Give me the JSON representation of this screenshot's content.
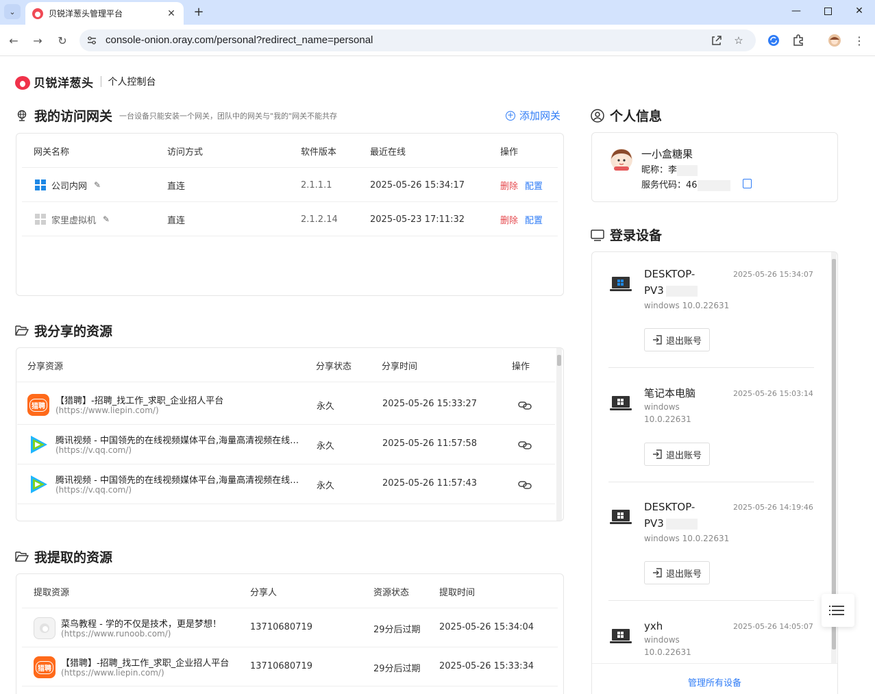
{
  "browser": {
    "tab_title": "贝锐洋葱头管理平台",
    "url": "console-onion.oray.com/personal?redirect_name=personal"
  },
  "brand": {
    "name": "贝锐洋葱头",
    "sub": "个人控制台"
  },
  "gateway": {
    "title": "我的访问网关",
    "hint": "一台设备只能安装一个网关，团队中的网关与\"我的\"网关不能共存",
    "add_label": "添加网关",
    "columns": [
      "网关名称",
      "访问方式",
      "软件版本",
      "最近在线",
      "操作"
    ],
    "rows": [
      {
        "name": "公司内网",
        "mode": "直连",
        "version": "2.1.1.1",
        "online": "2025-05-26 15:34:17",
        "del": "删除",
        "cfg": "配置",
        "active": true
      },
      {
        "name": "家里虚拟机",
        "mode": "直连",
        "version": "2.1.2.14",
        "online": "2025-05-23 17:11:32",
        "del": "删除",
        "cfg": "配置",
        "active": false
      }
    ]
  },
  "shared": {
    "title": "我分享的资源",
    "columns": [
      "分享资源",
      "分享状态",
      "分享时间",
      "操作"
    ],
    "rows": [
      {
        "title": "【猎聘】-招聘_找工作_求职_企业招人平台",
        "url": "(https://www.liepin.com/)",
        "status": "永久",
        "time": "2025-05-26 15:33:27",
        "icon": "liepin"
      },
      {
        "title": "腾讯视频 - 中国领先的在线视频媒体平台,海量高清视频在线观看",
        "url": "(https://v.qq.com/)",
        "status": "永久",
        "time": "2025-05-26 11:57:58",
        "icon": "tencent"
      },
      {
        "title": "腾讯视频 - 中国领先的在线视频媒体平台,海量高清视频在线观看",
        "url": "(https://v.qq.com/)",
        "status": "永久",
        "time": "2025-05-26 11:57:43",
        "icon": "tencent"
      }
    ]
  },
  "extracted": {
    "title": "我提取的资源",
    "columns": [
      "提取资源",
      "分享人",
      "资源状态",
      "提取时间"
    ],
    "rows": [
      {
        "title": "菜鸟教程 - 学的不仅是技术，更是梦想！",
        "url": "(https://www.runoob.com/)",
        "sharer": "13710680719",
        "status": "29分后过期",
        "time": "2025-05-26 15:34:04",
        "icon": "runoob"
      },
      {
        "title": "【猎聘】-招聘_找工作_求职_企业招人平台",
        "url": "(https://www.liepin.com/)",
        "sharer": "13710680719",
        "status": "29分后过期",
        "time": "2025-05-26 15:33:34",
        "icon": "liepin"
      }
    ]
  },
  "profile": {
    "title": "个人信息",
    "name": "一小盒糖果",
    "nickname_label": "昵称：李",
    "code_label": "服务代码：46"
  },
  "devices": {
    "title": "登录设备",
    "logout_label": "退出账号",
    "manage_all": "管理所有设备",
    "items": [
      {
        "name1": "DESKTOP-",
        "name2": "PV3",
        "os": "windows 10.0.22631",
        "time": "2025-05-26 15:34:07",
        "active": true
      },
      {
        "name1": "笔记本电脑",
        "name2": "",
        "os": "windows",
        "os2": "10.0.22631",
        "time": "2025-05-26 15:03:14",
        "active": false
      },
      {
        "name1": "DESKTOP-",
        "name2": "PV3",
        "os": "windows 10.0.22631",
        "time": "2025-05-26 14:19:46",
        "active": false
      },
      {
        "name1": "yxh",
        "name2": "",
        "os": "windows",
        "os2": "10.0.22631",
        "time": "2025-05-26 14:05:07",
        "active": false
      }
    ]
  },
  "colors": {
    "accent": "#2f7cf6",
    "danger": "#e5484d",
    "brand": "#f0324a"
  }
}
